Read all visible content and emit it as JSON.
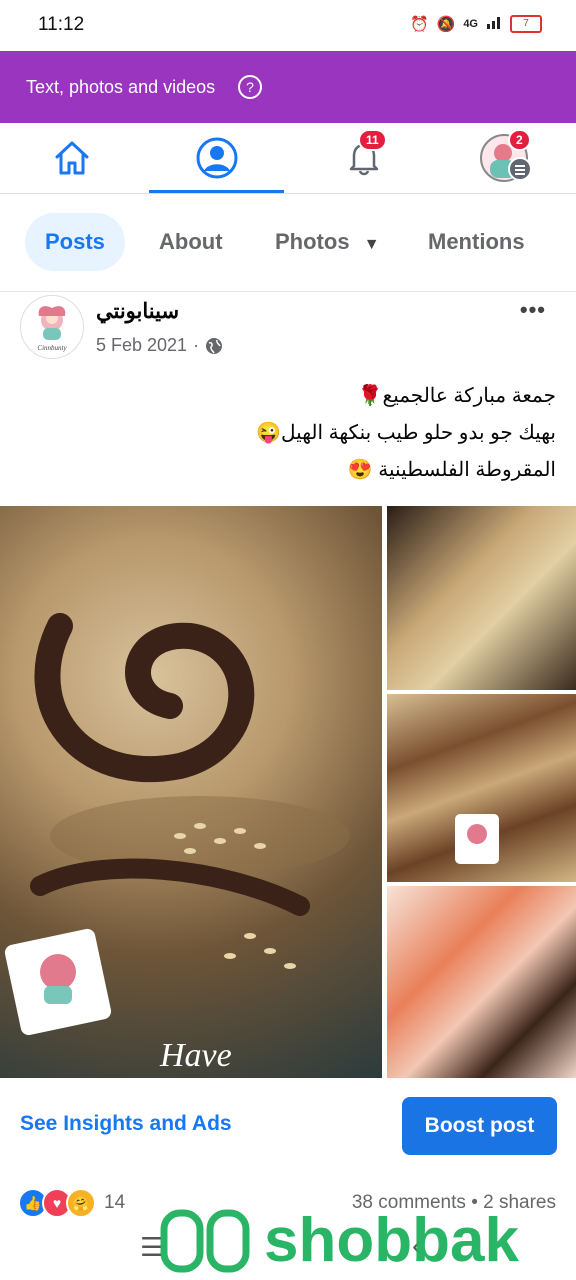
{
  "status_bar": {
    "time": "11:12",
    "network": "4G",
    "battery": "7"
  },
  "banner": {
    "text": "Text, photos and videos",
    "help_glyph": "?"
  },
  "nav": {
    "items": [
      {
        "name": "home",
        "icon": "home-icon"
      },
      {
        "name": "profile",
        "icon": "profile-icon",
        "active": true
      },
      {
        "name": "notifications",
        "icon": "bell-icon",
        "badge": "11"
      },
      {
        "name": "menu",
        "icon": "avatar-menu-icon",
        "badge": "2"
      }
    ],
    "accent": "#1877f2"
  },
  "tabs": [
    {
      "label": "Posts",
      "active": true
    },
    {
      "label": "About"
    },
    {
      "label": "Photos"
    },
    {
      "label": "Mentions"
    }
  ],
  "post": {
    "author": "سينابونتي",
    "date": "5 Feb 2021",
    "date_separator": "·",
    "more_glyph": "•••",
    "lines": [
      "جمعة مباركة عالجميع🌹",
      "بهيك جو بدو حلو طيب بنكهة الهيل😜",
      "المقروطة الفلسطينية 😍"
    ],
    "photo_overlay_text": "Have",
    "logo_text": "Cinnbunty"
  },
  "actions": {
    "insights_label": "See Insights and Ads",
    "boost_label": "Boost post"
  },
  "reactions": {
    "count": "14",
    "comments": "38 comments",
    "separator": "•",
    "shares": "2 shares"
  },
  "watermark": {
    "text": "shobbak",
    "color": "#1fb15d"
  }
}
